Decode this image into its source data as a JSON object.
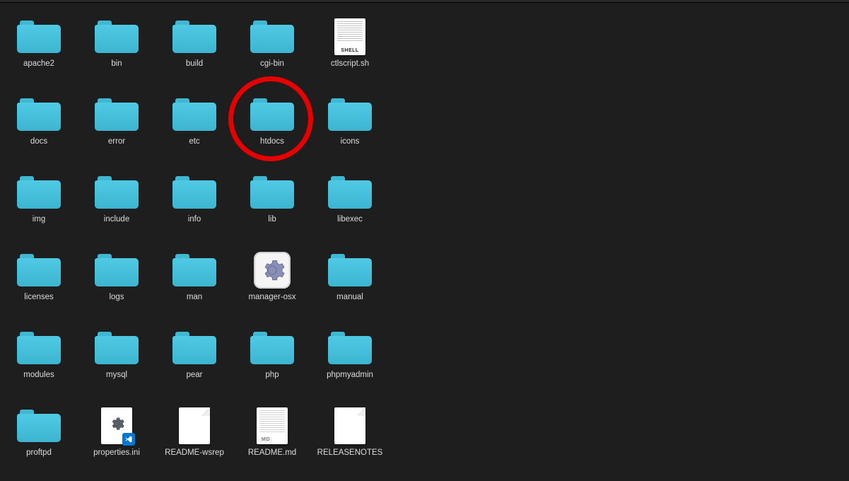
{
  "items": [
    {
      "type": "folder",
      "label": "apache2"
    },
    {
      "type": "folder",
      "label": "bin"
    },
    {
      "type": "folder",
      "label": "build"
    },
    {
      "type": "folder",
      "label": "cgi-bin"
    },
    {
      "type": "shell",
      "label": "ctlscript.sh",
      "tag": "SHELL"
    },
    {
      "type": "folder",
      "label": "docs"
    },
    {
      "type": "folder",
      "label": "error"
    },
    {
      "type": "folder",
      "label": "etc"
    },
    {
      "type": "folder",
      "label": "htdocs",
      "highlighted": true
    },
    {
      "type": "folder",
      "label": "icons"
    },
    {
      "type": "folder",
      "label": "img"
    },
    {
      "type": "folder",
      "label": "include"
    },
    {
      "type": "folder",
      "label": "info"
    },
    {
      "type": "folder",
      "label": "lib"
    },
    {
      "type": "folder",
      "label": "libexec"
    },
    {
      "type": "folder",
      "label": "licenses"
    },
    {
      "type": "folder",
      "label": "logs"
    },
    {
      "type": "folder",
      "label": "man"
    },
    {
      "type": "manager",
      "label": "manager-osx"
    },
    {
      "type": "folder",
      "label": "manual"
    },
    {
      "type": "folder",
      "label": "modules"
    },
    {
      "type": "folder",
      "label": "mysql"
    },
    {
      "type": "folder",
      "label": "pear"
    },
    {
      "type": "folder",
      "label": "php"
    },
    {
      "type": "folder",
      "label": "phpmyadmin"
    },
    {
      "type": "folder",
      "label": "proftpd"
    },
    {
      "type": "ini",
      "label": "properties.ini"
    },
    {
      "type": "plain",
      "label": "README-wsrep"
    },
    {
      "type": "md",
      "label": "README.md",
      "tag": "MD"
    },
    {
      "type": "plain",
      "label": "RELEASENOTES"
    }
  ],
  "columns_per_row": 5,
  "highlight_color": "#e60000"
}
